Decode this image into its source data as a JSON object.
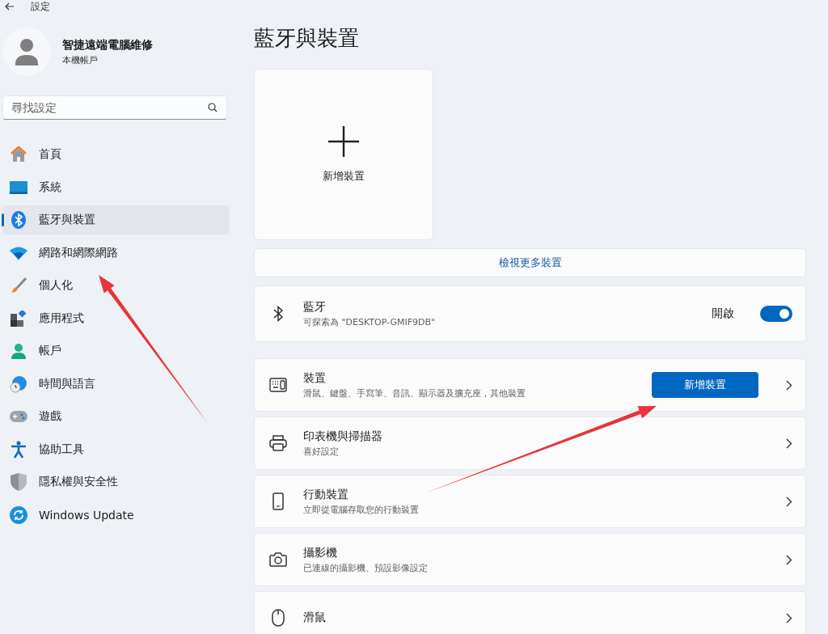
{
  "window": {
    "title": "設定"
  },
  "account": {
    "name": "智捷遠端電腦維修",
    "type": "本機帳戶"
  },
  "search": {
    "placeholder": "尋找設定"
  },
  "sidebar": {
    "items": [
      {
        "label": "首頁",
        "selected": false
      },
      {
        "label": "系統",
        "selected": false
      },
      {
        "label": "藍牙與裝置",
        "selected": true
      },
      {
        "label": "網路和網際網路",
        "selected": false
      },
      {
        "label": "個人化",
        "selected": false
      },
      {
        "label": "應用程式",
        "selected": false
      },
      {
        "label": "帳戶",
        "selected": false
      },
      {
        "label": "時間與語言",
        "selected": false
      },
      {
        "label": "遊戲",
        "selected": false
      },
      {
        "label": "協助工具",
        "selected": false
      },
      {
        "label": "隱私權與安全性",
        "selected": false
      },
      {
        "label": "Windows Update",
        "selected": false
      }
    ]
  },
  "page_title": "藍牙與裝置",
  "add_device_tile": {
    "label": "新增裝置"
  },
  "view_more": "檢視更多裝置",
  "bluetooth": {
    "title": "藍牙",
    "subtitle": "可探索為 \"DESKTOP-GMIF9DB\"",
    "state_label": "開啟",
    "on": true
  },
  "settings": [
    {
      "title": "裝置",
      "subtitle": "滑鼠、鍵盤、手寫筆、音訊、顯示器及擴充座，其他裝置",
      "button": "新增裝置"
    },
    {
      "title": "印表機與掃描器",
      "subtitle": "喜好設定"
    },
    {
      "title": "行動裝置",
      "subtitle": "立即從電腦存取您的行動裝置"
    },
    {
      "title": "攝影機",
      "subtitle": "已連線的攝影機、預設影像設定"
    },
    {
      "title": "滑鼠"
    }
  ],
  "annotations": [
    {
      "kind": "arrow"
    },
    {
      "kind": "arrow"
    }
  ]
}
